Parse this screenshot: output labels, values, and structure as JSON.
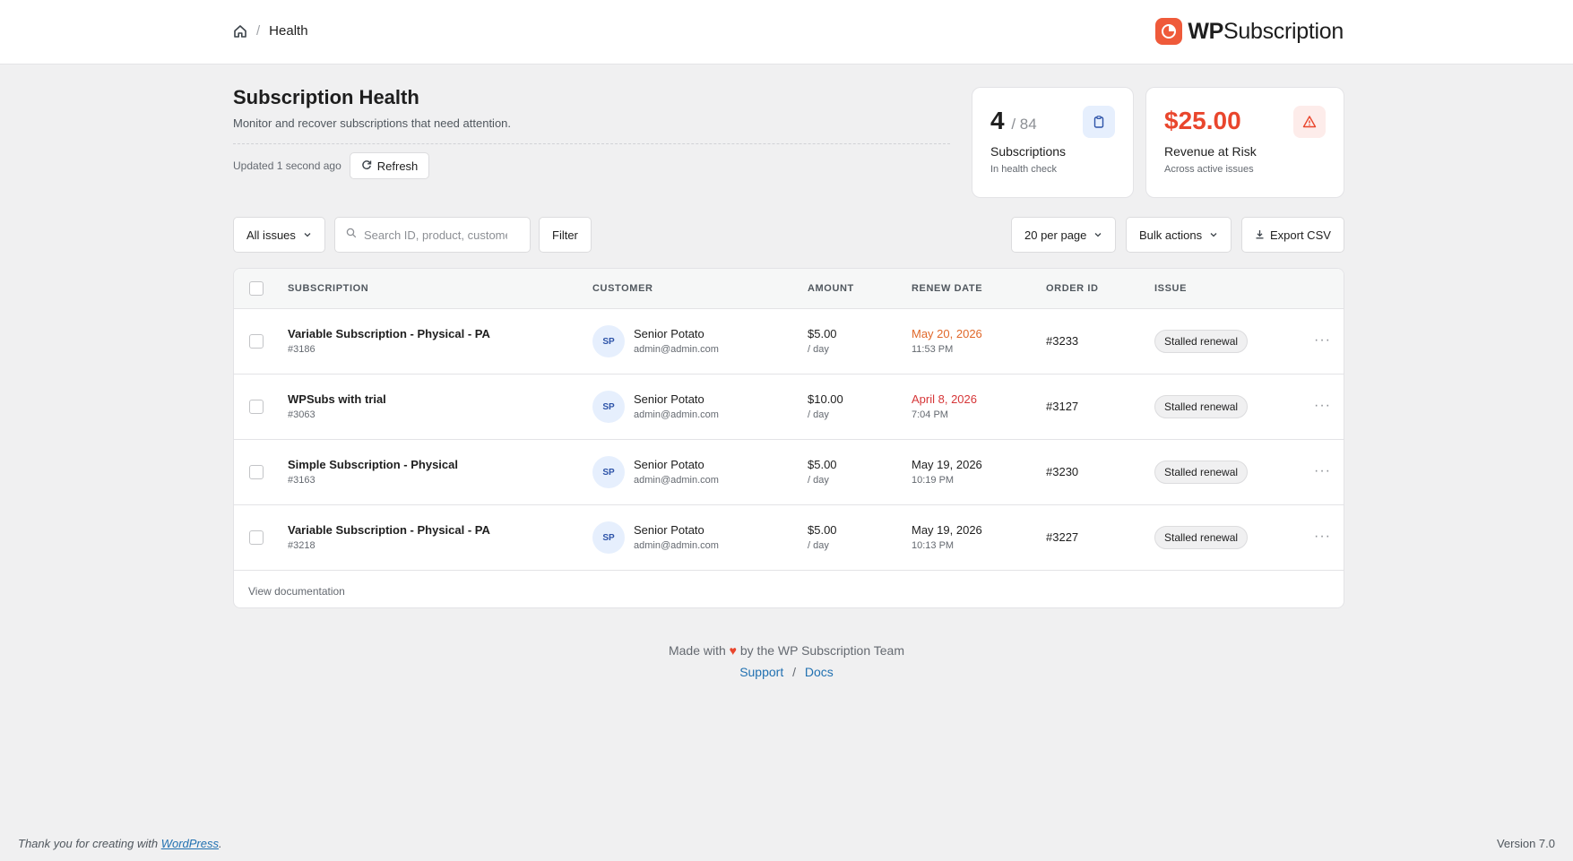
{
  "breadcrumb": {
    "current": "Health"
  },
  "logo": {
    "bold": "WP",
    "rest": "Subscription"
  },
  "header": {
    "title": "Subscription Health",
    "subtitle": "Monitor and recover subscriptions that need attention.",
    "updated": "Updated 1 second ago",
    "refresh_label": "Refresh"
  },
  "stats": {
    "subscriptions": {
      "value": "4",
      "total": "/ 84",
      "label": "Subscriptions",
      "sub": "In health check"
    },
    "revenue": {
      "value": "$25.00",
      "label": "Revenue at Risk",
      "sub": "Across active issues",
      "color": "#e9462d"
    }
  },
  "toolbar": {
    "issues_select": "All issues",
    "search_placeholder": "Search ID, product, customer",
    "filter_label": "Filter",
    "per_page": "20 per page",
    "bulk_actions": "Bulk actions",
    "export_label": "Export CSV"
  },
  "table": {
    "columns": {
      "subscription": "SUBSCRIPTION",
      "customer": "CUSTOMER",
      "amount": "AMOUNT",
      "renew": "RENEW DATE",
      "order": "ORDER ID",
      "issue": "ISSUE"
    },
    "rows": [
      {
        "name": "Variable Subscription - Physical - PA",
        "id": "#3186",
        "initials": "SP",
        "customer": "Senior Potato",
        "email": "admin@admin.com",
        "amount": "$5.00",
        "period": "/ day",
        "date": "May 20, 2026",
        "time": "11:53 PM",
        "order": "#3233",
        "issue": "Stalled renewal"
      },
      {
        "name": "WPSubs with trial",
        "id": "#3063",
        "initials": "SP",
        "customer": "Senior Potato",
        "email": "admin@admin.com",
        "amount": "$10.00",
        "period": "/ day",
        "date": "April 8, 2026",
        "time": "7:04 PM",
        "order": "#3127",
        "issue": "Stalled renewal"
      },
      {
        "name": "Simple Subscription - Physical",
        "id": "#3163",
        "initials": "SP",
        "customer": "Senior Potato",
        "email": "admin@admin.com",
        "amount": "$5.00",
        "period": "/ day",
        "date": "May 19, 2026",
        "time": "10:19 PM",
        "order": "#3230",
        "issue": "Stalled renewal"
      },
      {
        "name": "Variable Subscription - Physical - PA",
        "id": "#3218",
        "initials": "SP",
        "customer": "Senior Potato",
        "email": "admin@admin.com",
        "amount": "$5.00",
        "period": "/ day",
        "date": "May 19, 2026",
        "time": "10:13 PM",
        "order": "#3227",
        "issue": "Stalled renewal"
      }
    ],
    "footer_link": "View documentation"
  },
  "footer": {
    "made_with_pre": "Made with",
    "heart": "♥",
    "made_with_post": "by the WP Subscription Team",
    "support": "Support",
    "separator": "/",
    "docs": "Docs"
  },
  "wp_footer": {
    "thanks_pre": "Thank you for creating with",
    "wordpress": "WordPress",
    "thanks_post": ".",
    "version": "Version 7.0"
  },
  "icons": {
    "home": "home-icon",
    "search": "search-icon",
    "refresh": "refresh-icon",
    "chevron": "chevron-down-icon",
    "download": "download-icon",
    "clipboard": "clipboard-icon",
    "warning": "warning-icon",
    "more": "more-horizontal-icon"
  },
  "colors": {
    "accent": "#ef5a3a",
    "danger": "#e9462d",
    "date_orange": "#e0682a",
    "date_red": "#d63638",
    "link": "#2271b1"
  }
}
